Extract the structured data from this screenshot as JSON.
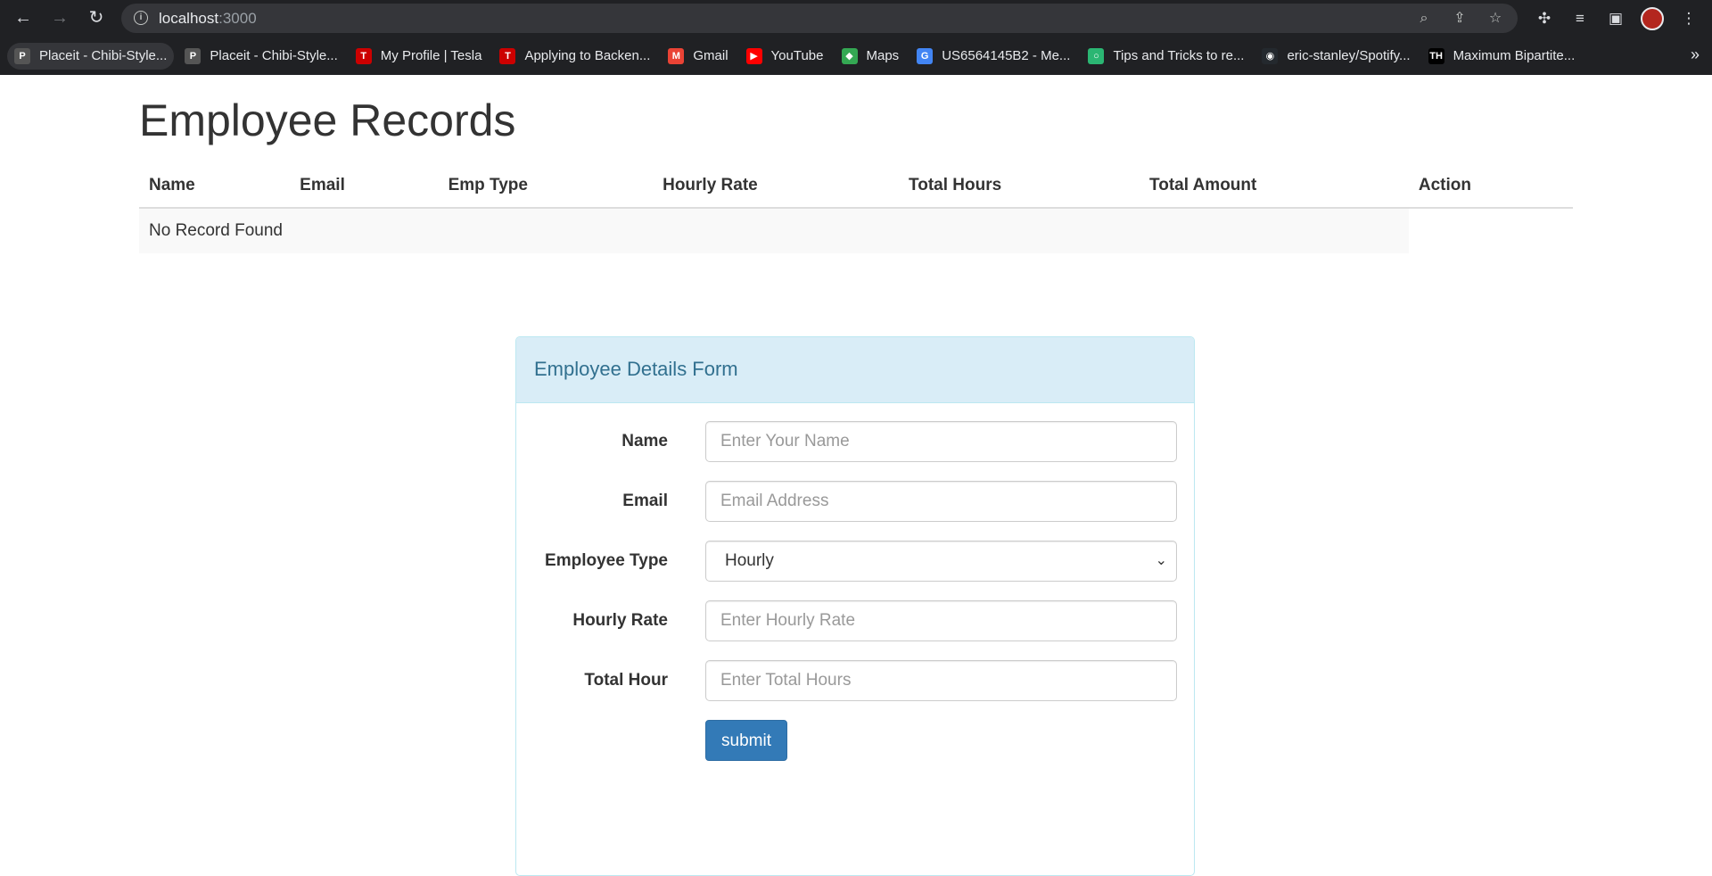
{
  "browser": {
    "url_host": "localhost",
    "url_port": ":3000",
    "bookmarks": [
      {
        "label": "Placeit - Chibi-Style...",
        "icon": "placeit-icon",
        "color": "#555555",
        "glyph": "P"
      },
      {
        "label": "Placeit - Chibi-Style...",
        "icon": "placeit-icon",
        "color": "#555555",
        "glyph": "P"
      },
      {
        "label": "My Profile | Tesla",
        "icon": "tesla-icon",
        "color": "#cc0000",
        "glyph": "T"
      },
      {
        "label": "Applying to Backen...",
        "icon": "tesla-icon",
        "color": "#cc0000",
        "glyph": "T"
      },
      {
        "label": "Gmail",
        "icon": "gmail-icon",
        "color": "#ea4335",
        "glyph": "M"
      },
      {
        "label": "YouTube",
        "icon": "youtube-icon",
        "color": "#ff0000",
        "glyph": "▶"
      },
      {
        "label": "Maps",
        "icon": "maps-icon",
        "color": "#34a853",
        "glyph": "◆"
      },
      {
        "label": "US6564145B2 - Me...",
        "icon": "google-icon",
        "color": "#4285f4",
        "glyph": "G"
      },
      {
        "label": "Tips and Tricks to re...",
        "icon": "ring-icon",
        "color": "#2bb673",
        "glyph": "○"
      },
      {
        "label": "eric-stanley/Spotify...",
        "icon": "github-icon",
        "color": "#24292e",
        "glyph": "◉"
      },
      {
        "label": "Maximum Bipartite...",
        "icon": "th-icon",
        "color": "#000000",
        "glyph": "TH"
      }
    ],
    "more": "»"
  },
  "page": {
    "title": "Employee Records",
    "table": {
      "columns": [
        "Name",
        "Email",
        "Emp Type",
        "Hourly Rate",
        "Total Hours",
        "Total Amount",
        "Action"
      ],
      "empty_message": "No Record Found"
    }
  },
  "form": {
    "heading": "Employee Details Form",
    "name_label": "Name",
    "name_placeholder": "Enter Your Name",
    "email_label": "Email",
    "email_placeholder": "Email Address",
    "type_label": "Employee Type",
    "type_value": "Hourly",
    "rate_label": "Hourly Rate",
    "rate_placeholder": "Enter Hourly Rate",
    "hours_label": "Total Hour",
    "hours_placeholder": "Enter Total Hours",
    "submit_label": "submit"
  },
  "colors": {
    "primary": "#337ab7",
    "panel_heading_bg": "#d9edf7",
    "panel_heading_text": "#31708f"
  }
}
